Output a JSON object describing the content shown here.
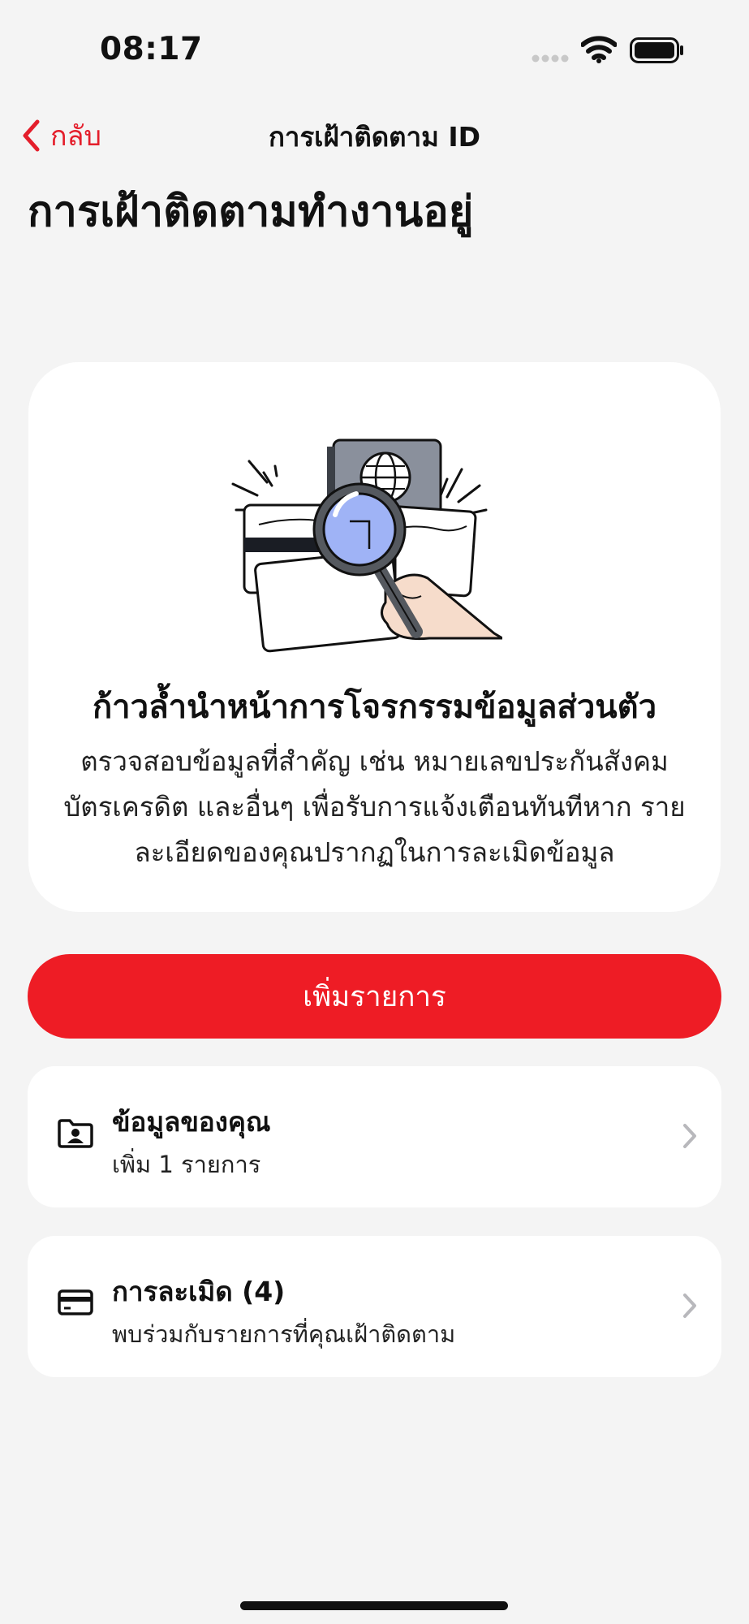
{
  "status_bar": {
    "time": "08:17",
    "icons": [
      "cellular-signal-icon",
      "wifi-icon",
      "battery-icon"
    ]
  },
  "nav": {
    "back_label": "กลับ",
    "title": "การเฝ้าติดตาม ID",
    "back_icon": "chevron-left-icon"
  },
  "page": {
    "title": "การเฝ้าติดตามทำงานอยู่"
  },
  "hero": {
    "illustration": "magnifier-over-id-cards-illustration",
    "heading": "ก้าวล้ำนำหน้าการโจรกรรมข้อมูลส่วนตัว",
    "body": "ตรวจสอบข้อมูลที่สำคัญ เช่น หมายเลขประกันสังคม บัตรเครดิต และอื่นๆ เพื่อรับการแจ้งเตือนทันทีหาก รายละเอียดของคุณปรากฏในการละเมิดข้อมูล"
  },
  "actions": {
    "add_label": "เพิ่มรายการ"
  },
  "list": [
    {
      "icon": "folder-person-icon",
      "title": "ข้อมูลของคุณ",
      "subtitle": "เพิ่ม 1 รายการ"
    },
    {
      "icon": "credit-card-icon",
      "title": "การละเมิด (4)",
      "subtitle": "พบร่วมกับรายการที่คุณเฝ้าติดตาม"
    }
  ],
  "colors": {
    "accent": "#ee1c25",
    "background": "#f4f4f4",
    "card": "#ffffff"
  }
}
